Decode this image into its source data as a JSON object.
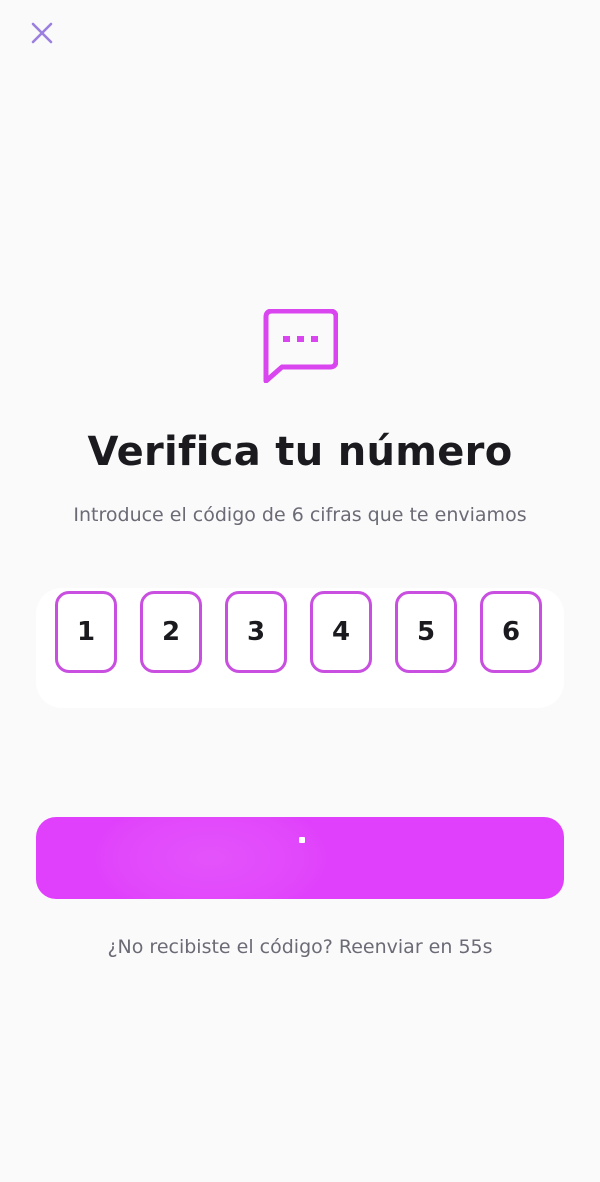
{
  "header": {
    "close_icon": "close-icon",
    "close_color": "#9b7fe0"
  },
  "hero": {
    "icon": "message-dots-icon",
    "icon_color": "#d946ef"
  },
  "title": "Verifica tu número",
  "subtitle": "Introduce el código de 6 cifras que te enviamos",
  "code": {
    "digits": [
      "1",
      "2",
      "3",
      "4",
      "5",
      "6"
    ],
    "border_color": "#c84fe0"
  },
  "submit_button": {
    "state": "loading",
    "color": "#e040fb"
  },
  "resend": {
    "prefix": "¿No recibiste el código?",
    "action": "Reenviar en 55s"
  }
}
